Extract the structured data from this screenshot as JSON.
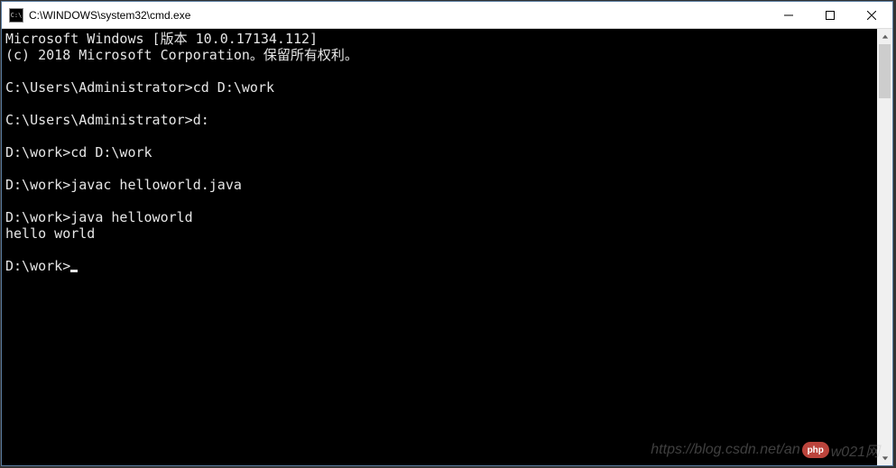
{
  "window": {
    "icon_text": "C:\\",
    "title": "C:\\WINDOWS\\system32\\cmd.exe"
  },
  "terminal": {
    "lines": [
      "Microsoft Windows [版本 10.0.17134.112]",
      "(c) 2018 Microsoft Corporation。保留所有权利。",
      "",
      "C:\\Users\\Administrator>cd D:\\work",
      "",
      "C:\\Users\\Administrator>d:",
      "",
      "D:\\work>cd D:\\work",
      "",
      "D:\\work>javac helloworld.java",
      "",
      "D:\\work>java helloworld",
      "hello world",
      "",
      "D:\\work>"
    ]
  },
  "watermark": {
    "text_left": "https://blog.csdn.net/an",
    "badge": "php",
    "text_right": "w021网"
  }
}
